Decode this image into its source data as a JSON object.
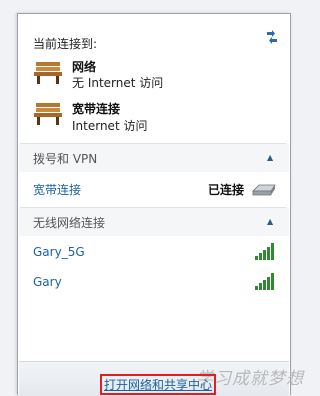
{
  "header": {
    "title": "当前连接到:"
  },
  "connections": [
    {
      "name": "网络",
      "status": "无 Internet 访问",
      "icon": "bench-icon"
    },
    {
      "name": "宽带连接",
      "status": "Internet 访问",
      "icon": "bench-icon"
    }
  ],
  "dialup": {
    "section_label": "拨号和 VPN",
    "item_name": "宽带连接",
    "item_status": "已连接",
    "item_icon": "modem-icon"
  },
  "wireless": {
    "section_label": "无线网络连接",
    "networks": [
      {
        "name": "Gary_5G",
        "signal": 5
      },
      {
        "name": "Gary",
        "signal": 5
      }
    ]
  },
  "footer": {
    "link_label": "打开网络和共享中心"
  },
  "watermark": "学习成就梦想",
  "colors": {
    "link": "#1a62a3",
    "signal": "#2e8b2e",
    "highlight": "#e02020"
  }
}
